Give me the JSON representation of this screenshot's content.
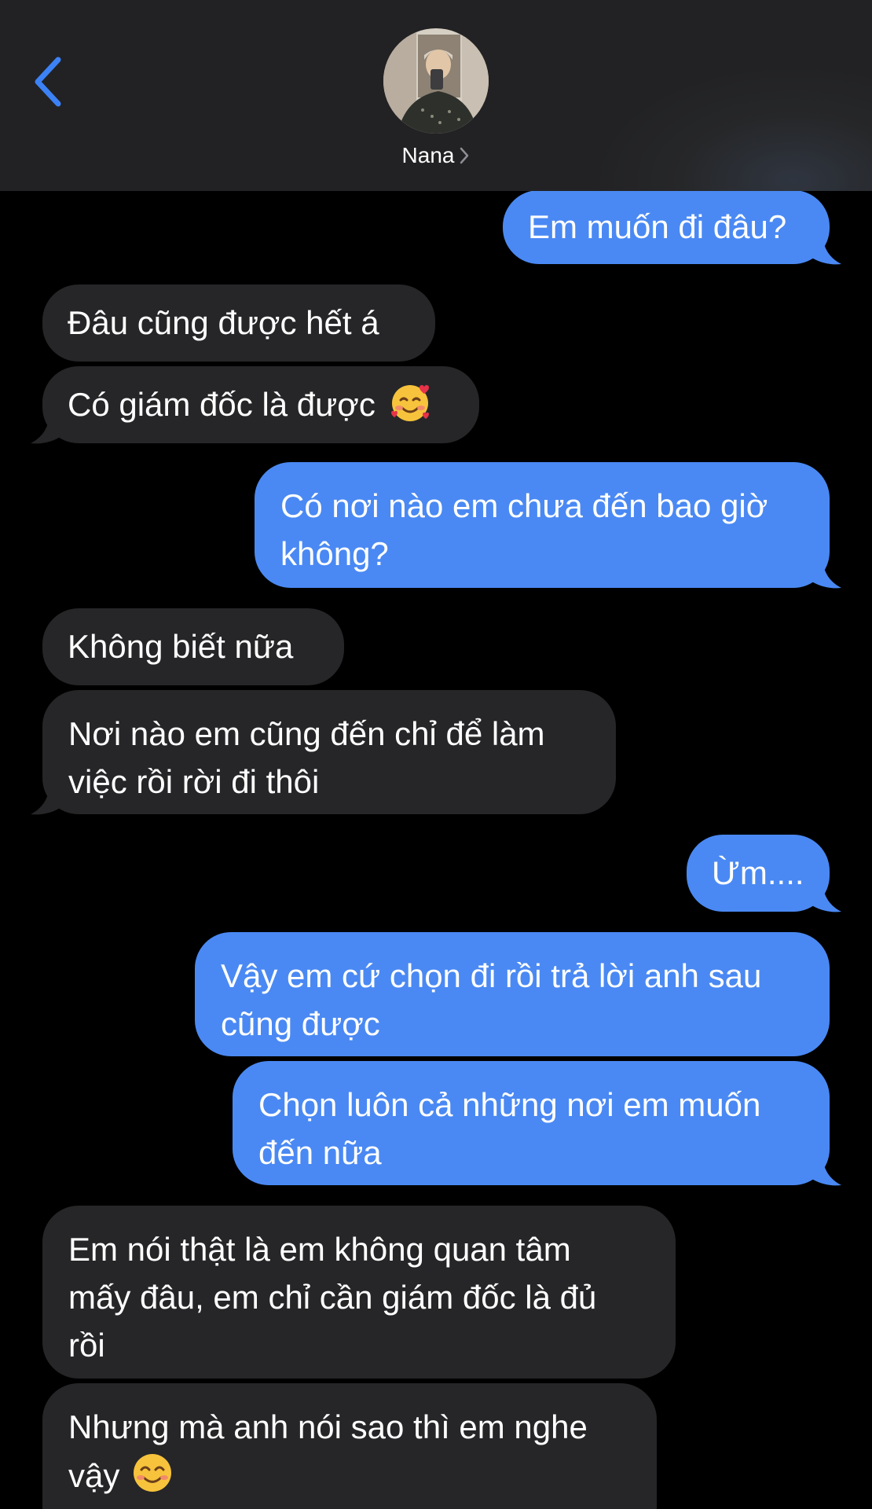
{
  "header": {
    "contact_name": "Nana",
    "icons": {
      "back": "chevron-left-icon",
      "details": "chevron-right-icon"
    }
  },
  "colors": {
    "outgoing_bubble": "#4a89f3",
    "incoming_bubble": "#262628",
    "header_background": "#262729",
    "accent": "#3c82f6",
    "background": "#000000"
  },
  "messages": [
    {
      "direction": "out",
      "lines": [
        "Em muốn đi đâu?"
      ]
    },
    {
      "direction": "in",
      "lines": [
        "Đâu cũng được hết á"
      ]
    },
    {
      "direction": "in",
      "lines": [
        "Có giám đốc là được"
      ],
      "emoji": "smiling-face-with-hearts"
    },
    {
      "direction": "out",
      "lines": [
        "Có nơi nào em chưa đến bao giờ",
        "không?"
      ]
    },
    {
      "direction": "in",
      "lines": [
        "Không biết nữa"
      ]
    },
    {
      "direction": "in",
      "lines": [
        "Nơi nào em cũng đến chỉ để làm",
        "việc rồi rời đi thôi"
      ]
    },
    {
      "direction": "out",
      "lines": [
        "Ừm...."
      ]
    },
    {
      "direction": "out",
      "lines": [
        "Vậy em cứ chọn đi rồi trả lời anh sau",
        "cũng được"
      ]
    },
    {
      "direction": "out",
      "lines": [
        "Chọn luôn cả những nơi em muốn",
        "đến nữa"
      ]
    },
    {
      "direction": "in",
      "lines": [
        "Em nói thật là em không quan tâm",
        "mấy đâu, em chỉ cần giám đốc là đủ",
        "rồi"
      ]
    },
    {
      "direction": "in",
      "lines": [
        "Nhưng mà anh nói sao thì em nghe",
        "vậy"
      ],
      "emoji": "smiling-face-with-smiling-eyes"
    }
  ]
}
